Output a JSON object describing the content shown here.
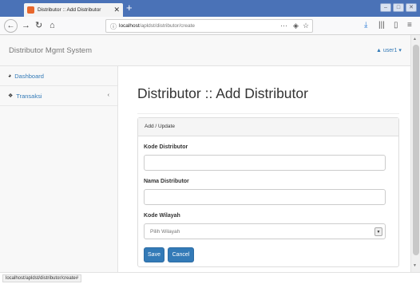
{
  "browser": {
    "tab_title": "Distributor :: Add Distributor",
    "tab_close": "✕",
    "new_tab": "+",
    "url_host": "localhost",
    "url_path": "/apldst/distributor/create",
    "page_actions": "···",
    "status_url": "localhost/apldst/distributor/create#"
  },
  "header": {
    "brand": "Distributor Mgmt System",
    "user": "user1"
  },
  "sidebar": {
    "items": [
      {
        "label": "Dashboard"
      },
      {
        "label": "Transaksi",
        "chevron": "‹"
      }
    ]
  },
  "main": {
    "title": "Distributor :: Add Distributor",
    "panel_heading": "Add / Update",
    "fields": [
      {
        "label": "Kode Distributor",
        "value": ""
      },
      {
        "label": "Nama Distributor",
        "value": ""
      },
      {
        "label": "Kode Wilayah",
        "selected": "Pilih Wilayah"
      }
    ],
    "save_label": "Save",
    "cancel_label": "Cancel"
  },
  "colors": {
    "tabbar": "#4a72b7",
    "link": "#337ab7",
    "button": "#337ab7"
  },
  "icons": {
    "dashboard": "dashboard-icon",
    "transaksi": "sitemap-icon",
    "user": "user-icon"
  }
}
